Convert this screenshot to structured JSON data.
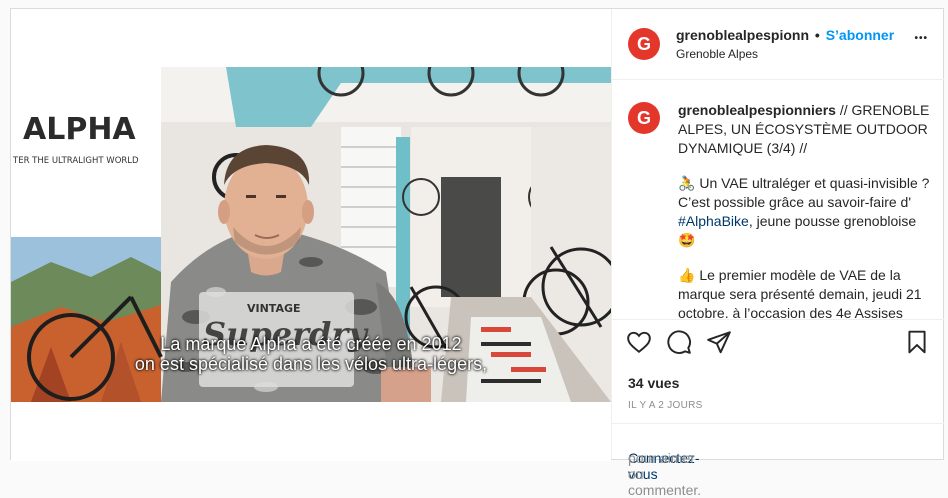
{
  "post": {
    "username": "grenoblealpespionn",
    "follow_label": "S’abonner",
    "dot": "•",
    "location": "Grenoble Alpes",
    "more_label": "•••",
    "avatar_letter": "G",
    "brand_color": "#e4372b",
    "accent_color": "#0095f6"
  },
  "video": {
    "brand_sign": "ALPHA",
    "brand_tagline": "TER THE ULTRALIGHT WORLD",
    "shirt_top": "VINTAGE",
    "shirt_main": "Superdry",
    "subtitle_line1": "La marque Alpha a été créée en 2012",
    "subtitle_line2": "on est spécialisé dans les vélos ultra-légers,"
  },
  "caption": {
    "author": "grenoblealpespionniers",
    "p1": " // GRENOBLE ALPES, UN ÉCOSYSTÈME OUTDOOR DYNAMIQUE (3/4) //",
    "p2_emoji": "🚴",
    "p2_before": " Un VAE ultraléger et quasi-invisible ? C’est possible grâce au savoir-faire d' ",
    "p2_hashtag": "#AlphaBike",
    "p2_after": ", jeune pousse grenobloise 🤩",
    "p3_emoji": "👍",
    "p3_text": " Le premier modèle de VAE de la marque sera présenté demain, jeudi 21 octobre. à l’occasion des 4e Assises"
  },
  "actions": {
    "like_icon": "heart-icon",
    "comment_icon": "comment-icon",
    "share_icon": "paper-plane-icon",
    "save_icon": "bookmark-icon"
  },
  "stats": {
    "views": "34 vues",
    "timestamp": "IL Y A 2 JOURS"
  },
  "login": {
    "link": "Connectez-vous",
    "text": " pour aimer ou commenter."
  }
}
